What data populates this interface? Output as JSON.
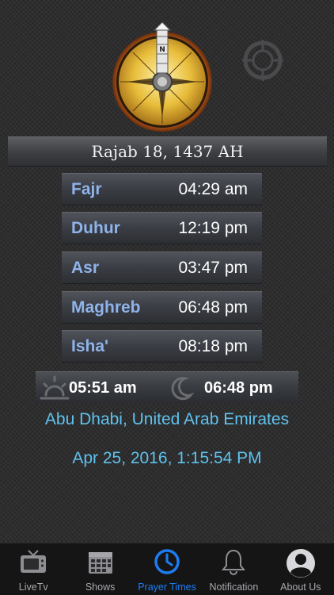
{
  "hijri_date": "Rajab 18, 1437 AH",
  "prayers": [
    {
      "name": "Fajr",
      "time": "04:29 am"
    },
    {
      "name": "Duhur",
      "time": "12:19 pm"
    },
    {
      "name": "Asr",
      "time": "03:47 pm"
    },
    {
      "name": "Maghreb",
      "time": "06:48 pm"
    },
    {
      "name": "Isha'",
      "time": "08:18 pm"
    }
  ],
  "sunrise": "05:51 am",
  "sunset": "06:48 pm",
  "location": "Abu Dhabi, United Arab Emirates",
  "current_datetime": "Apr 25, 2016, 1:15:54 PM",
  "compass": {
    "north_label": "N"
  },
  "icons": {
    "compass": "compass-icon",
    "locate": "crosshair-icon",
    "sunrise": "sunrise-icon",
    "sunset": "moon-icon"
  },
  "tabs": [
    {
      "label": "LiveTv",
      "icon": "tv-icon",
      "active": false
    },
    {
      "label": "Shows",
      "icon": "calendar-icon",
      "active": false
    },
    {
      "label": "Prayer Times",
      "icon": "clock-icon",
      "active": true
    },
    {
      "label": "Notification",
      "icon": "bell-icon",
      "active": false
    },
    {
      "label": "About Us",
      "icon": "person-icon",
      "active": false
    }
  ],
  "colors": {
    "accent": "#1d7cf2",
    "prayer_name": "#8fb3ea",
    "info_text": "#5fc2ee",
    "tab_inactive": "#a9a9ad"
  }
}
